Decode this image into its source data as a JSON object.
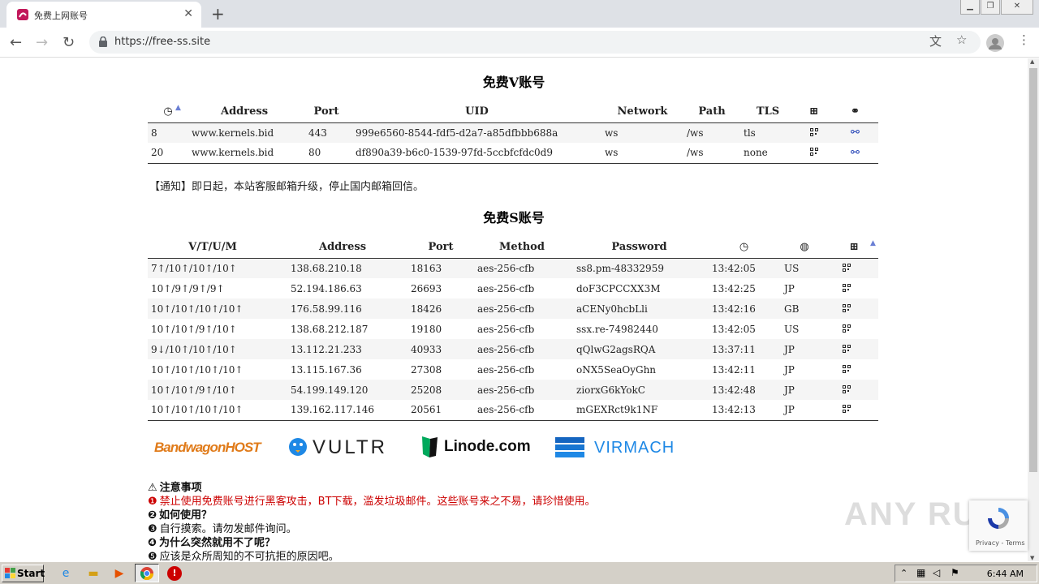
{
  "browser": {
    "tab_title": "免费上网账号",
    "url": "https://free-ss.site"
  },
  "v_section": {
    "title": "免费V账号",
    "headers": [
      "",
      "Address",
      "Port",
      "UID",
      "Network",
      "Path",
      "TLS",
      "",
      ""
    ],
    "rows": [
      [
        "8",
        "www.kernels.bid",
        "443",
        "999e6560-8544-fdf5-d2a7-a85dfbbb688a",
        "ws",
        "/ws",
        "tls"
      ],
      [
        "20",
        "www.kernels.bid",
        "80",
        "df890a39-b6c0-1539-97fd-5ccbfcfdc0d9",
        "ws",
        "/ws",
        "none"
      ]
    ]
  },
  "notice": "【通知】即日起，本站客服邮箱升级，停止国内邮箱回信。",
  "s_section": {
    "title": "免费S账号",
    "headers": [
      "V/T/U/M",
      "Address",
      "Port",
      "Method",
      "Password",
      "",
      "",
      ""
    ],
    "rows": [
      [
        "7↑/10↑/10↑/10↑",
        "138.68.210.18",
        "18163",
        "aes-256-cfb",
        "ss8.pm-48332959",
        "13:42:05",
        "US"
      ],
      [
        "10↑/9↑/9↑/9↑",
        "52.194.186.63",
        "26693",
        "aes-256-cfb",
        "doF3CPCCXX3M",
        "13:42:25",
        "JP"
      ],
      [
        "10↑/10↑/10↑/10↑",
        "176.58.99.116",
        "18426",
        "aes-256-cfb",
        "aCENy0hcbLli",
        "13:42:16",
        "GB"
      ],
      [
        "10↑/10↑/9↑/10↑",
        "138.68.212.187",
        "19180",
        "aes-256-cfb",
        "ssx.re-74982440",
        "13:42:05",
        "US"
      ],
      [
        "9↓/10↑/10↑/10↑",
        "13.112.21.233",
        "40933",
        "aes-256-cfb",
        "qQlwG2agsRQA",
        "13:37:11",
        "JP"
      ],
      [
        "10↑/10↑/10↑/10↑",
        "13.115.167.36",
        "27308",
        "aes-256-cfb",
        "oNX5SeaOyGhn",
        "13:42:11",
        "JP"
      ],
      [
        "10↑/10↑/9↑/10↑",
        "54.199.149.120",
        "25208",
        "aes-256-cfb",
        "ziorxG6kYokC",
        "13:42:48",
        "JP"
      ],
      [
        "10↑/10↑/10↑/10↑",
        "139.162.117.146",
        "20561",
        "aes-256-cfb",
        "mGEXRct9k1NF",
        "13:42:13",
        "JP"
      ]
    ]
  },
  "sponsors": [
    "BandwagonHOST",
    "VULTR",
    "Linode.com",
    "VIRMACH"
  ],
  "faq": [
    {
      "icon": "⚠",
      "text": "注意事项",
      "style": "b"
    },
    {
      "icon": "❶",
      "text": "禁止使用免费账号进行黑客攻击，BT下载，滥发垃圾邮件。这些账号来之不易，请珍惜使用。",
      "style": "red"
    },
    {
      "icon": "❷",
      "text": "如何使用？",
      "style": "b"
    },
    {
      "icon": "❸",
      "text": "自行摸索。请勿发邮件询问。",
      "style": ""
    },
    {
      "icon": "❹",
      "text": "为什么突然就用不了呢？",
      "style": "b"
    },
    {
      "icon": "❺",
      "text": "应该是众所周知的不可抗拒的原因吧。",
      "style": ""
    }
  ],
  "taskbar": {
    "start": "Start",
    "clock": "6:44 AM"
  },
  "recaptcha": {
    "text": "Privacy - Terms"
  },
  "watermark": "ANY RUN"
}
